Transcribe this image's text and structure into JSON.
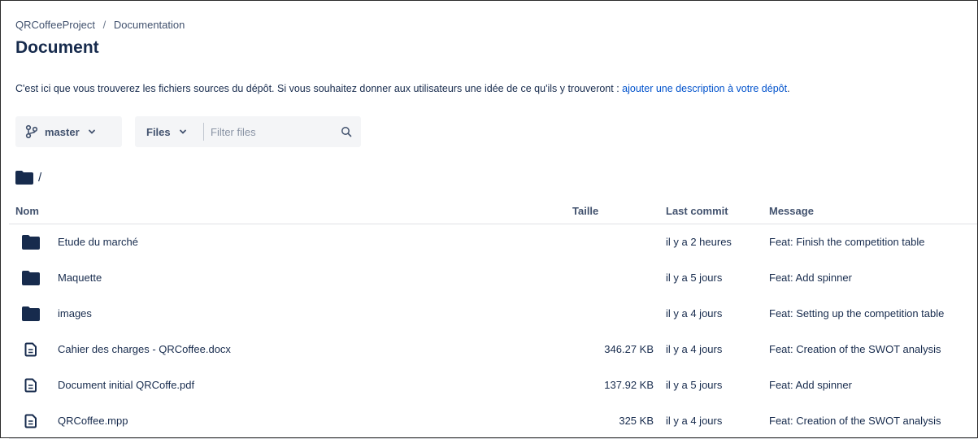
{
  "breadcrumb": {
    "project": "QRCoffeeProject",
    "separator": "/",
    "section": "Documentation"
  },
  "page_title": "Document",
  "description": {
    "text": "C'est ici que vous trouverez les fichiers sources du dépôt. Si vous souhaitez donner aux utilisateurs une idée de ce qu'ils y trouveront : ",
    "link": "ajouter une description à votre dépôt",
    "suffix": "."
  },
  "branch": {
    "label": "master",
    "icon": "branch-icon"
  },
  "filter": {
    "type_label": "Files",
    "placeholder": "Filter files",
    "icon": "search-icon"
  },
  "path": {
    "label": "/",
    "icon": "folder-icon"
  },
  "table": {
    "headers": {
      "name": "Nom",
      "size": "Taille",
      "commit": "Last commit",
      "message": "Message"
    },
    "rows": [
      {
        "type": "folder",
        "icon": "folder-icon",
        "name": "Etude du marché",
        "size": "",
        "commit": "il y a 2 heures",
        "message": "Feat: Finish the competition table"
      },
      {
        "type": "folder",
        "icon": "folder-icon",
        "name": "Maquette",
        "size": "",
        "commit": "il y a 5 jours",
        "message": "Feat: Add spinner"
      },
      {
        "type": "folder",
        "icon": "folder-icon",
        "name": "images",
        "size": "",
        "commit": "il y a 4 jours",
        "message": "Feat: Setting up the competition table"
      },
      {
        "type": "file",
        "icon": "file-icon",
        "name": "Cahier des charges - QRCoffee.docx",
        "size": "346.27 KB",
        "commit": "il y a 4 jours",
        "message": "Feat: Creation of the SWOT analysis"
      },
      {
        "type": "file",
        "icon": "file-icon",
        "name": "Document initial QRCoffe.pdf",
        "size": "137.92 KB",
        "commit": "il y a 5 jours",
        "message": "Feat: Add spinner"
      },
      {
        "type": "file",
        "icon": "file-icon",
        "name": "QRCoffee.mpp",
        "size": "325 KB",
        "commit": "il y a 4 jours",
        "message": "Feat: Creation of the SWOT analysis"
      }
    ]
  },
  "colors": {
    "link": "#0052cc",
    "text": "#172b4d",
    "muted": "#42526e",
    "folder": "#172b4d"
  }
}
